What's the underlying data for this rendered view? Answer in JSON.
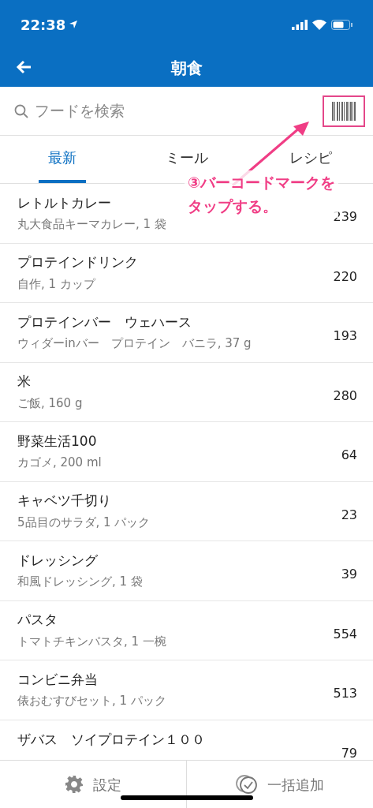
{
  "status_bar": {
    "time": "22:38"
  },
  "nav": {
    "title": "朝食"
  },
  "search": {
    "placeholder": "フードを検索"
  },
  "tabs": [
    {
      "label": "最新",
      "selected": true
    },
    {
      "label": "ミール",
      "selected": false
    },
    {
      "label": "レシピ",
      "selected": false
    }
  ],
  "foods": [
    {
      "name": "レトルトカレー",
      "detail": "丸大食品キーマカレー, 1 袋",
      "calories": "239"
    },
    {
      "name": "プロテインドリンク",
      "detail": "自作, 1 カップ",
      "calories": "220"
    },
    {
      "name": "プロテインバー　ウェハース",
      "detail": "ウィダーinバー　プロテイン　バニラ, 37 g",
      "calories": "193"
    },
    {
      "name": "米",
      "detail": "ご飯, 160 g",
      "calories": "280"
    },
    {
      "name": "野菜生活100",
      "detail": "カゴメ, 200 ml",
      "calories": "64"
    },
    {
      "name": "キャベツ千切り",
      "detail": "5品目のサラダ, 1 パック",
      "calories": "23"
    },
    {
      "name": "ドレッシング",
      "detail": "和風ドレッシング, 1 袋",
      "calories": "39"
    },
    {
      "name": "パスタ",
      "detail": "トマトチキンパスタ, 1 一椀",
      "calories": "554"
    },
    {
      "name": "コンビニ弁当",
      "detail": "俵おむすびセット, 1 パック",
      "calories": "513"
    },
    {
      "name": "ザバス　ソイプロテイン１００",
      "calories": "79"
    }
  ],
  "footer": [
    {
      "kind": "settings",
      "label": "設定"
    },
    {
      "kind": "bulk",
      "label": "一括追加"
    }
  ],
  "annotation": {
    "lines": [
      "③バーコードマークを",
      "タップする。"
    ]
  }
}
